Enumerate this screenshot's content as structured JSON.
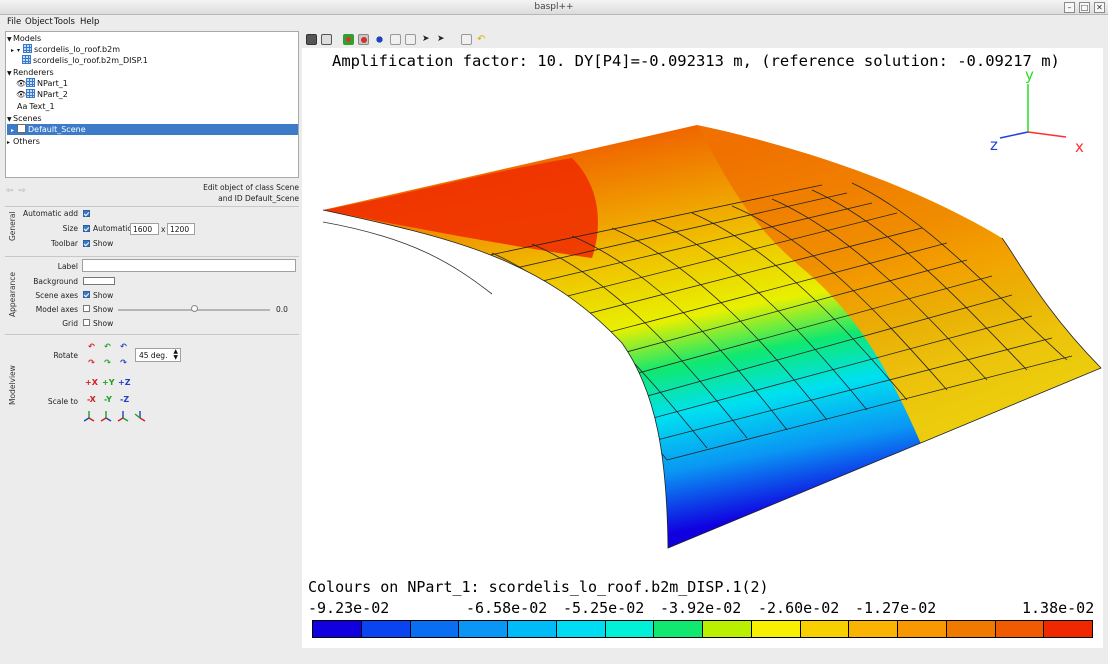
{
  "window": {
    "title": "baspl++"
  },
  "menu": [
    "File",
    "Object",
    "Tools",
    "Help"
  ],
  "tree": {
    "models_label": "Models",
    "model_name": "scordelis_lo_roof.b2m",
    "model_child": "scordelis_lo_roof.b2m_DISP.1",
    "renderers_label": "Renderers",
    "renderers": [
      "NPart_1",
      "NPart_2",
      "Text_1"
    ],
    "text_prefix": "Aa",
    "scenes_label": "Scenes",
    "scene": "Default_Scene",
    "others_label": "Others"
  },
  "edit_info": {
    "line1": "Edit object of class Scene",
    "line2": "and ID Default_Scene"
  },
  "general": {
    "group": "General",
    "automatic_add": "Automatic add",
    "size": "Size",
    "automatic": "Automatic",
    "width": "1600",
    "x": "x",
    "height": "1200",
    "toolbar": "Toolbar",
    "show": "Show"
  },
  "appearance": {
    "group": "Appearance",
    "label": "Label",
    "label_value": "",
    "background": "Background",
    "scene_axes": "Scene axes",
    "model_axes": "Model axes",
    "grid": "Grid",
    "show": "Show",
    "slider_value": "0.0",
    "slider_fraction": 0.0
  },
  "modelview": {
    "group": "Modelview",
    "rotate": "Rotate",
    "angle": "45 deg.",
    "scale_to": "Scale to",
    "plus_axes": [
      "+X",
      "+Y",
      "+Z"
    ],
    "minus_axes": [
      "-X",
      "-Y",
      "-Z"
    ]
  },
  "viewport": {
    "title": "Amplification factor: 10. DY[P4]=-0.092313 m, (reference solution: -0.09217 m)",
    "axes": {
      "x": "x",
      "y": "y",
      "z": "z"
    },
    "legend_title": "Colours on NPart_1: scordelis_lo_roof.b2m_DISP.1(2)",
    "legend_ticks": [
      "-9.23e-02",
      "-6.58e-02",
      "-5.25e-02",
      "-3.92e-02",
      "-2.60e-02",
      "-1.27e-02",
      "1.38e-02"
    ],
    "colorbar": [
      "#1000e0",
      "#0a44f0",
      "#0a6ef2",
      "#0a96f4",
      "#00bcf6",
      "#00dcf2",
      "#00f0d8",
      "#10e870",
      "#b8f000",
      "#f8f000",
      "#f8d000",
      "#f8b400",
      "#f89800",
      "#f07a00",
      "#f05a00",
      "#f02800"
    ]
  }
}
